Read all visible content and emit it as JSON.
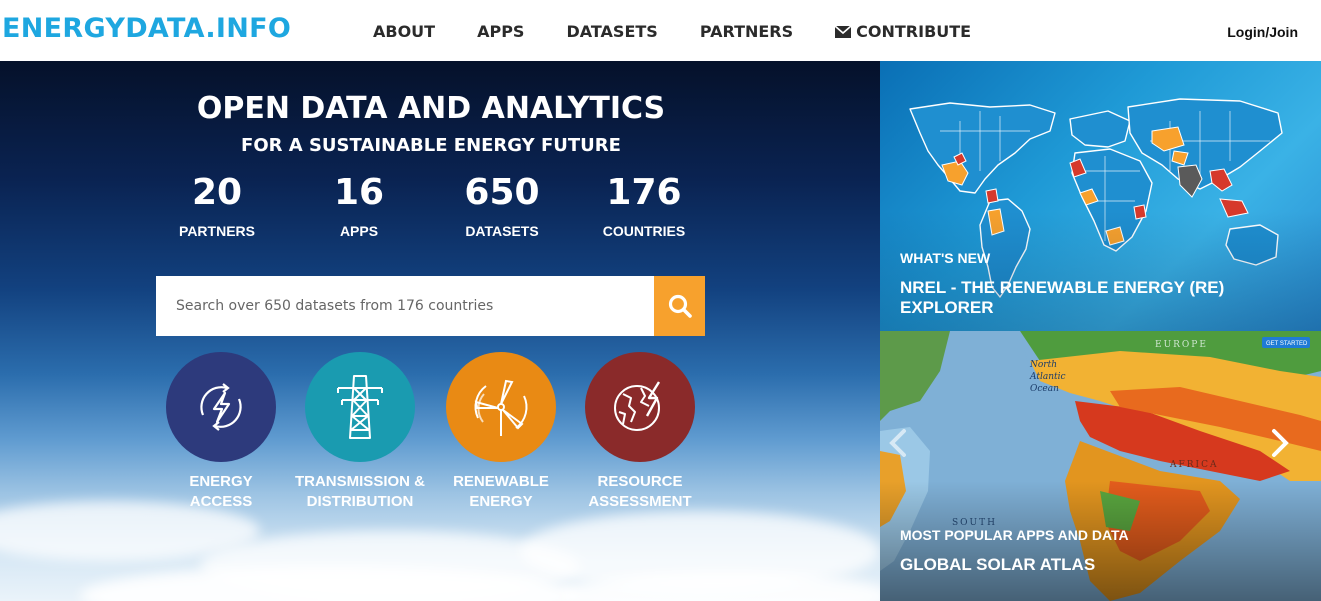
{
  "header": {
    "logo": "ENERGYDATA.INFO",
    "nav": [
      {
        "label": "ABOUT"
      },
      {
        "label": "APPS"
      },
      {
        "label": "DATASETS"
      },
      {
        "label": "PARTNERS"
      },
      {
        "label": "CONTRIBUTE",
        "icon": "envelope-icon"
      }
    ],
    "login": "Login/Join"
  },
  "hero": {
    "title": "OPEN DATA AND ANALYTICS",
    "subtitle": "FOR A SUSTAINABLE ENERGY FUTURE",
    "stats": [
      {
        "value": "20",
        "label": "PARTNERS"
      },
      {
        "value": "16",
        "label": "APPS"
      },
      {
        "value": "650",
        "label": "DATASETS"
      },
      {
        "value": "176",
        "label": "COUNTRIES"
      }
    ],
    "search": {
      "placeholder": "Search over 650 datasets from 176 countries",
      "button_icon": "search-icon"
    },
    "categories": [
      {
        "line1": "ENERGY",
        "line2": "ACCESS",
        "color": "#2d3a7c",
        "icon": "energy-access-icon"
      },
      {
        "line1": "TRANSMISSION &",
        "line2": "DISTRIBUTION",
        "color": "#1a9bb0",
        "icon": "transmission-tower-icon"
      },
      {
        "line1": "RENEWABLE",
        "line2": "ENERGY",
        "color": "#e98a14",
        "icon": "wind-turbine-icon"
      },
      {
        "line1": "RESOURCE",
        "line2": "ASSESSMENT",
        "color": "#8a2a2a",
        "icon": "globe-bolt-icon"
      }
    ]
  },
  "panels": {
    "whats_new": {
      "kicker": "WHAT'S NEW",
      "title": "NREL - THE RENEWABLE ENERGY (RE) EXPLORER"
    },
    "popular": {
      "kicker": "MOST POPULAR APPS AND DATA",
      "title": "GLOBAL SOLAR ATLAS",
      "map_labels": {
        "europe": "EUROPE",
        "ocean": "North Atlantic Ocean",
        "africa": "AFRICA",
        "south": "SOUTH",
        "button": "GET STARTED"
      }
    }
  },
  "colors": {
    "brand": "#1ea7e0",
    "search_button": "#f7a12d"
  }
}
